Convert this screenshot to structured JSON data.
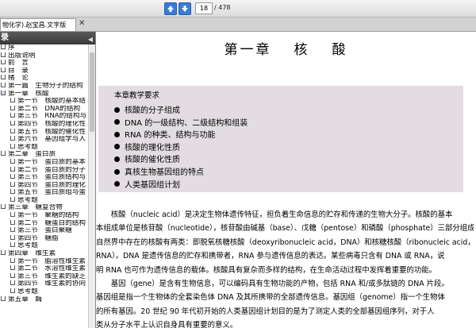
{
  "toolbar": {
    "current_page": "18",
    "total_pages": "/ 478"
  },
  "tab": {
    "title": "物化学).赵宝昌.文字版"
  },
  "sidebar": {
    "header": "录",
    "items": [
      {
        "label": "序",
        "level": 1
      },
      {
        "label": "出版说明",
        "level": 1
      },
      {
        "label": "前　言",
        "level": 1
      },
      {
        "label": "目　录",
        "level": 1
      },
      {
        "label": "绪　论",
        "level": 1
      },
      {
        "label": "第一篇　生物分子的结构",
        "level": 1
      },
      {
        "label": "第一章　核酸",
        "level": 1,
        "folder": true
      },
      {
        "label": "第一节　核酸的基本结",
        "level": 2
      },
      {
        "label": "第二节　DNA的结构",
        "level": 2
      },
      {
        "label": "第三节　RNA的结构与",
        "level": 2
      },
      {
        "label": "第四节　核酸的理化性",
        "level": 2
      },
      {
        "label": "第五节　核酸的催化性",
        "level": 2
      },
      {
        "label": "第六节　基因组学与人",
        "level": 2
      },
      {
        "label": "思考题",
        "level": 2
      },
      {
        "label": "第二章　蛋白质",
        "level": 1
      },
      {
        "label": "第一节　蛋白质的基本",
        "level": 2
      },
      {
        "label": "第二节　蛋白质的分子",
        "level": 2
      },
      {
        "label": "第三节　蛋白质结构与",
        "level": 2
      },
      {
        "label": "第四节　蛋白质的理化",
        "level": 2
      },
      {
        "label": "第五节　蛋白质组与蛋",
        "level": 2
      },
      {
        "label": "思考题",
        "level": 2
      },
      {
        "label": "第三章　糖复合物",
        "level": 1
      },
      {
        "label": "第一节　聚糖的结构",
        "level": 2
      },
      {
        "label": "第二节　糖蛋白的结构",
        "level": 2
      },
      {
        "label": "第三节　蛋白聚糖",
        "level": 2
      },
      {
        "label": "第四节　糖脂",
        "level": 2
      },
      {
        "label": "思考题",
        "level": 2
      },
      {
        "label": "第四章　维生素",
        "level": 1
      },
      {
        "label": "第一节　脂溶性维生素",
        "level": 2
      },
      {
        "label": "第二节　水溶性维生素",
        "level": 2
      },
      {
        "label": "第三节　维生素的缺乏",
        "level": 2
      },
      {
        "label": "第四节　维生素的协同",
        "level": 2
      },
      {
        "label": "思考题",
        "level": 2
      },
      {
        "label": "第五章　酶",
        "level": 1
      }
    ]
  },
  "document": {
    "chapter_word1": "第一章",
    "chapter_word2": "核",
    "chapter_word3": "酸",
    "objectives_heading": "本章教学要求",
    "objectives": [
      "核酸的分子组成",
      "DNA 的一级结构、二级结构和组装",
      "RNA 的种类、结构与功能",
      "核酸的理化性质",
      "核酸的催化性质",
      "真核生物基因组的特点",
      "人类基因组计划"
    ],
    "paragraph_lines": [
      "　　核酸（nucleic acid）是决定生物体遗传特征，担负着生命信息的贮存和传递的生物大分子。核酸的基本",
      "本组成单位是核苷酸（nucleotide），核苷酸由碱基（base）、戊糖（pentose）和磷酸（phosphate）三部分组成。",
      "自然界中存在的核酸有两类：即脱氧核糖核酸（deoxyribonucleic acid，DNA）和核糖核酸（ribonucleic acid，",
      "RNA）。DNA 是遗传信息的贮存和携带者，RNA 参与遗传信息的表达。某些病毒只含有 DNA 或 RNA，说",
      "明 RNA 也可作为遗传信息的载体。核酸具有复杂而多样的结构，在生命活动过程中发挥着重要的功能。",
      "　　基因（gene）是含有生物信息，可以编码具有生物功能的产物，包括 RNA 和/或多肽链的 DNA 片段。",
      "基因组是指一个生物体的全套染色体 DNA 及其所携带的全部遗传信息。基因组（genome）指一个生物体",
      "的所有基因。20 世纪 90 年代初开始的人类基因组计划目的是为了测定人类的全部基因组序列，对于人",
      "类从分子水平上认识自身具有重要的意义。"
    ]
  }
}
